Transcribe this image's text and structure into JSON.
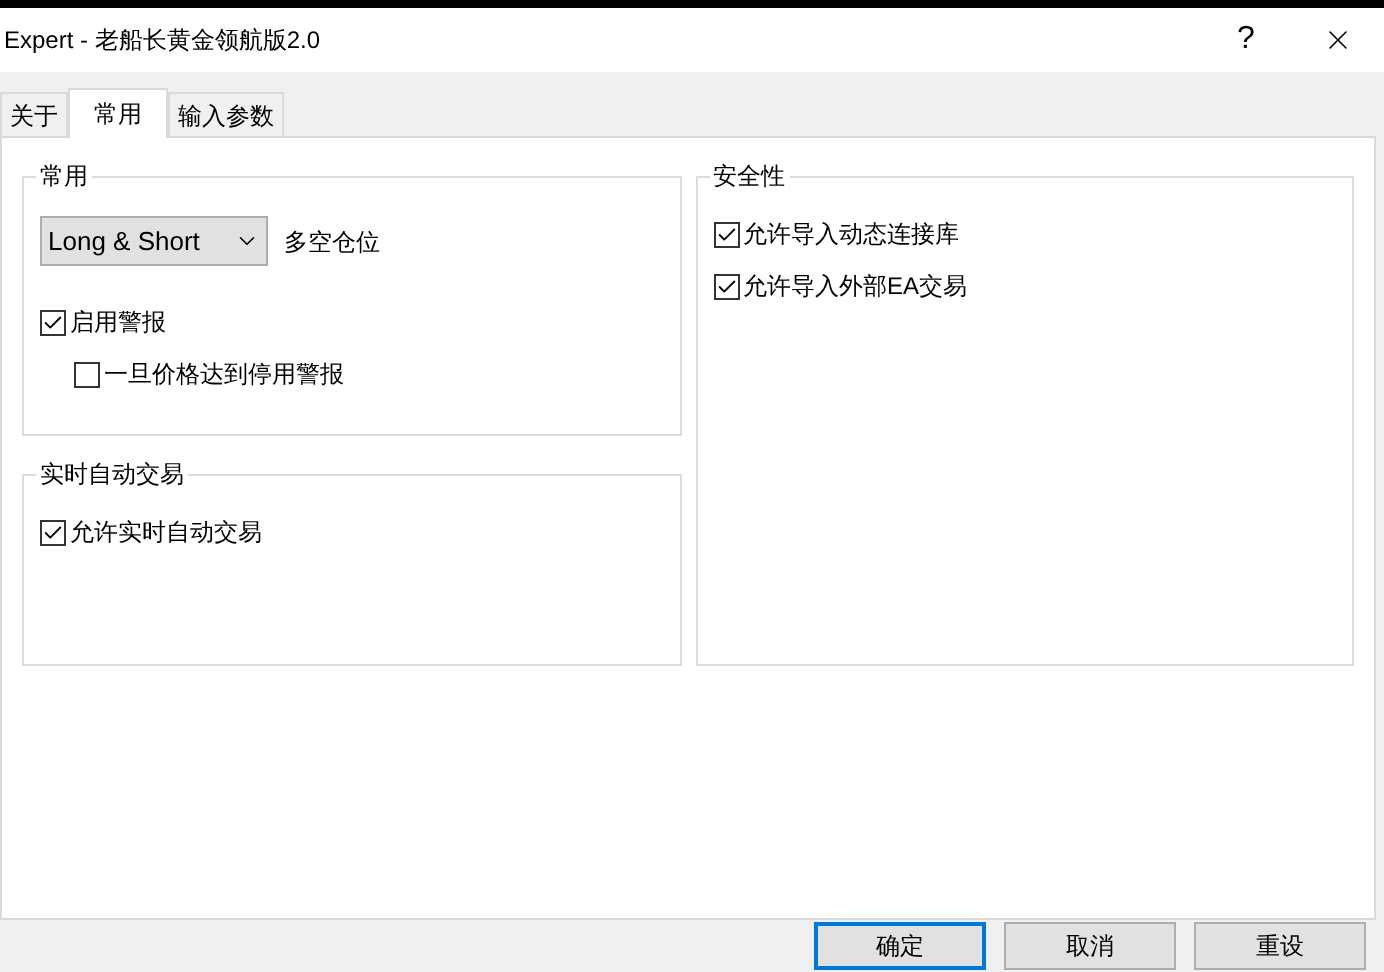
{
  "window": {
    "title": "Expert - 老船长黄金领航版2.0",
    "help": "?"
  },
  "tabs": [
    {
      "label": "关于",
      "selected": false
    },
    {
      "label": "常用",
      "selected": true
    },
    {
      "label": "输入参数",
      "selected": false
    }
  ],
  "columns": [
    {
      "groups": [
        {
          "title": "常用",
          "items": [
            {
              "kind": "dropdown",
              "value": "Long & Short",
              "label": "多空仓位"
            },
            {
              "kind": "checkbox",
              "label": "启用警报",
              "checked": true,
              "children": [
                {
                  "kind": "checkbox",
                  "label": "一旦价格达到停用警报",
                  "checked": false
                }
              ]
            }
          ]
        },
        {
          "title": "实时自动交易",
          "items": [
            {
              "kind": "checkbox",
              "label": "允许实时自动交易",
              "checked": true
            }
          ]
        }
      ]
    },
    {
      "groups": [
        {
          "title": "安全性",
          "items": [
            {
              "kind": "checkbox",
              "label": "允许导入动态连接库",
              "checked": true
            },
            {
              "kind": "checkbox",
              "label": "允许导入外部EA交易",
              "checked": true
            }
          ]
        }
      ]
    }
  ],
  "buttons": [
    {
      "label": "确定",
      "focused": true
    },
    {
      "label": "取消",
      "focused": false
    },
    {
      "label": "重设",
      "focused": false
    }
  ]
}
